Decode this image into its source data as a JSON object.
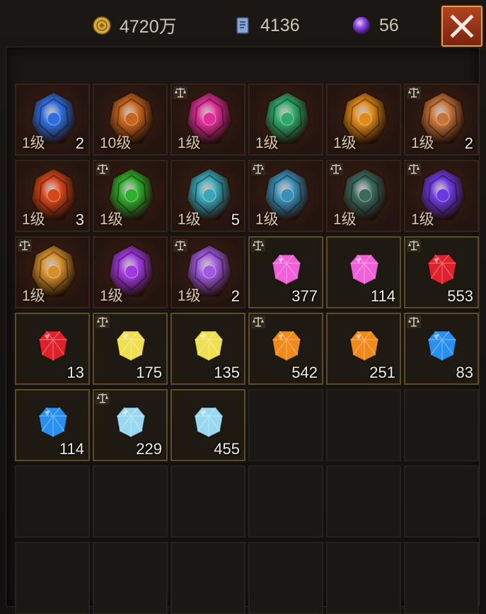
{
  "currencies": {
    "gold": {
      "value": "4720万",
      "icon": "gold-coin-icon"
    },
    "ticket": {
      "value": "4136",
      "icon": "scroll-ticket-icon"
    },
    "orb": {
      "value": "56",
      "icon": "purple-orb-icon"
    }
  },
  "close": {
    "icon": "close-icon"
  },
  "colors": {
    "equip_bg": "#2e1a12",
    "gem_border": "#5e4a23",
    "close_bg": "#a83a1a"
  },
  "items": [
    {
      "kind": "equip",
      "icon": "blue-rune-shield-icon",
      "color": "#2f6fe0",
      "level": "1级",
      "qty": "2",
      "tradable": false
    },
    {
      "kind": "equip",
      "icon": "amber-lantern-shield-icon",
      "color": "#c7651e",
      "level": "10级",
      "qty": "",
      "tradable": false
    },
    {
      "kind": "equip",
      "icon": "pink-crystal-heart-icon",
      "color": "#e02f9a",
      "level": "1级",
      "qty": "",
      "tradable": true
    },
    {
      "kind": "equip",
      "icon": "green-shard-icon",
      "color": "#2fa86b",
      "level": "1级",
      "qty": "",
      "tradable": false
    },
    {
      "kind": "equip",
      "icon": "amber-orb-icon",
      "color": "#e08a1a",
      "level": "1级",
      "qty": "",
      "tradable": false
    },
    {
      "kind": "equip",
      "icon": "bronze-crest-icon",
      "color": "#c7743a",
      "level": "1级",
      "qty": "2",
      "tradable": true
    },
    {
      "kind": "equip",
      "icon": "fire-stone-icon",
      "color": "#d6461a",
      "level": "1级",
      "qty": "3",
      "tradable": false
    },
    {
      "kind": "equip",
      "icon": "emerald-amulet-icon",
      "color": "#2fae2f",
      "level": "1级",
      "qty": "",
      "tradable": true
    },
    {
      "kind": "equip",
      "icon": "teal-scale-shield-icon",
      "color": "#3aa6b8",
      "level": "1级",
      "qty": "5",
      "tradable": false
    },
    {
      "kind": "equip",
      "icon": "teal-scale-shield-icon",
      "color": "#3a8fb8",
      "level": "1级",
      "qty": "",
      "tradable": true
    },
    {
      "kind": "equip",
      "icon": "dark-teal-shard-icon",
      "color": "#3a6a5e",
      "level": "1级",
      "qty": "",
      "tradable": true
    },
    {
      "kind": "equip",
      "icon": "violet-cluster-icon",
      "color": "#6a3ae0",
      "level": "1级",
      "qty": "",
      "tradable": true
    },
    {
      "kind": "equip",
      "icon": "amber-rune-stone-icon",
      "color": "#d6902e",
      "level": "1级",
      "qty": "",
      "tradable": true
    },
    {
      "kind": "equip",
      "icon": "violet-crystal-icon",
      "color": "#a03ae0",
      "level": "1级",
      "qty": "",
      "tradable": false
    },
    {
      "kind": "equip",
      "icon": "violet-crystal-shard-icon",
      "color": "#a05ae0",
      "level": "1级",
      "qty": "2",
      "tradable": true
    },
    {
      "kind": "gem",
      "icon": "pink-gem-icon",
      "color": "#f060d8",
      "level": "",
      "qty": "377",
      "tradable": true
    },
    {
      "kind": "gem",
      "icon": "pink-gem-icon",
      "color": "#f060d8",
      "level": "",
      "qty": "114",
      "tradable": false
    },
    {
      "kind": "gem",
      "icon": "red-gem-icon",
      "color": "#e0202a",
      "level": "",
      "qty": "553",
      "tradable": true
    },
    {
      "kind": "gem",
      "icon": "red-gem-icon",
      "color": "#e0202a",
      "level": "",
      "qty": "13",
      "tradable": false
    },
    {
      "kind": "gem",
      "icon": "yellow-gem-icon",
      "color": "#f0e050",
      "level": "",
      "qty": "175",
      "tradable": true
    },
    {
      "kind": "gem",
      "icon": "yellow-gem-icon",
      "color": "#f0e050",
      "level": "",
      "qty": "135",
      "tradable": false
    },
    {
      "kind": "gem",
      "icon": "orange-gem-icon",
      "color": "#f08a1a",
      "level": "",
      "qty": "542",
      "tradable": true
    },
    {
      "kind": "gem",
      "icon": "orange-gem-icon",
      "color": "#f08a1a",
      "level": "",
      "qty": "251",
      "tradable": false
    },
    {
      "kind": "gem",
      "icon": "blue-gem-icon",
      "color": "#2a90f0",
      "level": "",
      "qty": "83",
      "tradable": true
    },
    {
      "kind": "gem",
      "icon": "blue-gem-icon",
      "color": "#2a90f0",
      "level": "",
      "qty": "114",
      "tradable": false
    },
    {
      "kind": "gem",
      "icon": "ice-gem-icon",
      "color": "#9ad8f0",
      "level": "",
      "qty": "229",
      "tradable": true
    },
    {
      "kind": "gem",
      "icon": "ice-gem-icon",
      "color": "#9ad8f0",
      "level": "",
      "qty": "455",
      "tradable": false
    },
    {
      "kind": "empty"
    },
    {
      "kind": "empty"
    },
    {
      "kind": "empty"
    },
    {
      "kind": "empty"
    },
    {
      "kind": "empty"
    },
    {
      "kind": "empty"
    },
    {
      "kind": "empty"
    },
    {
      "kind": "empty"
    },
    {
      "kind": "empty"
    },
    {
      "kind": "empty"
    },
    {
      "kind": "empty"
    },
    {
      "kind": "empty"
    },
    {
      "kind": "empty"
    },
    {
      "kind": "empty"
    },
    {
      "kind": "empty"
    }
  ]
}
